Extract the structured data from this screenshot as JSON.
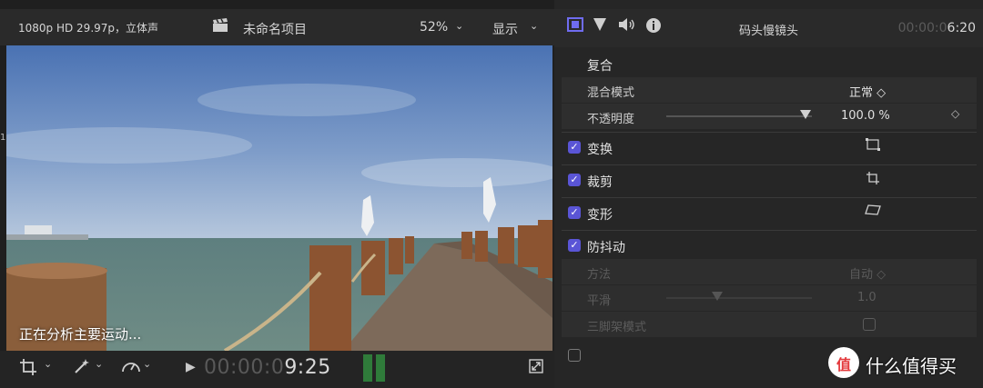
{
  "viewer": {
    "format_info": "1080p HD 29.97p，立体声",
    "project_title": "未命名项目",
    "zoom": "52%",
    "view_menu": "显示",
    "status": "正在分析主要运动...",
    "timecode_dim": "00:00:0",
    "timecode_lit": "9:25",
    "edge_marker": "1"
  },
  "inspector": {
    "clip_name": "码头慢镜头",
    "duration_dim": "00:00:0",
    "duration_lit": "6:20",
    "composite": {
      "title": "复合",
      "blend_mode_label": "混合模式",
      "blend_mode_value": "正常 ◇",
      "opacity_label": "不透明度",
      "opacity_value": "100.0",
      "opacity_unit": "%",
      "opacity_fraction": 1.0
    },
    "sections": {
      "transform": "变换",
      "crop": "裁剪",
      "distort": "变形",
      "stabilization": "防抖动"
    },
    "stabilization": {
      "method_label": "方法",
      "method_value": "自动 ◇",
      "smoothing_label": "平滑",
      "smoothing_value": "1.0",
      "tripod_label": "三脚架模式"
    }
  },
  "watermark": {
    "text": "什么值得买",
    "logo_text": "值"
  },
  "colors": {
    "accent": "#5a55d6",
    "background": "#232323",
    "meter": "#2f7b3a"
  }
}
